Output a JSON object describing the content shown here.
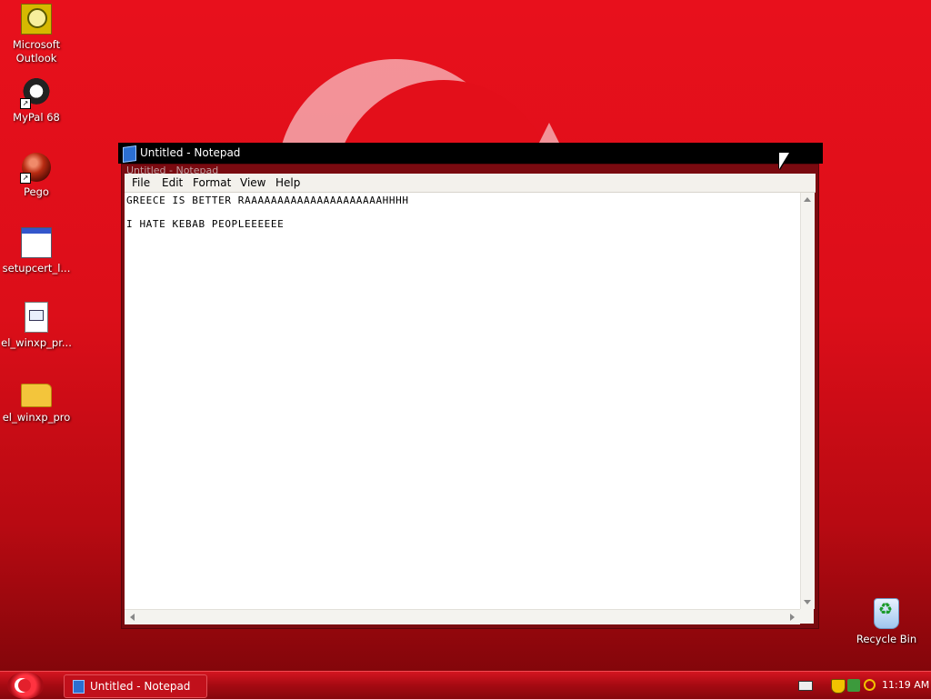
{
  "desktop": {
    "icons": [
      {
        "label": "Microsoft Outlook",
        "icon": "outlook-icon"
      },
      {
        "label": "MyPal 68",
        "icon": "mypal-icon"
      },
      {
        "label": "Pego",
        "icon": "pego-icon"
      },
      {
        "label": "setupcert_l...",
        "icon": "setup-exe-icon"
      },
      {
        "label": "el_winxp_pr...",
        "icon": "document-icon"
      },
      {
        "label": "el_winxp_pro",
        "icon": "folder-icon"
      }
    ],
    "recycle_bin": {
      "label": "Recycle Bin",
      "icon": "recycle-bin-icon"
    }
  },
  "window": {
    "title": "Untitled - Notepad",
    "ghost_title": "Untitled - Notepad",
    "menu": [
      "File",
      "Edit",
      "Format",
      "View",
      "Help"
    ],
    "content_lines": [
      "GREECE IS BETTER RAAAAAAAAAAAAAAAAAAAAAHHHH",
      "",
      "I HATE KEBAB PEOPLEEEEEE"
    ]
  },
  "taskbar": {
    "task_label": "Untitled - Notepad",
    "clock": "11:19 AM"
  },
  "colors": {
    "desktop_red": "#e30f1a",
    "taskbar_red": "#a50a12",
    "titlebar": "#000000"
  }
}
